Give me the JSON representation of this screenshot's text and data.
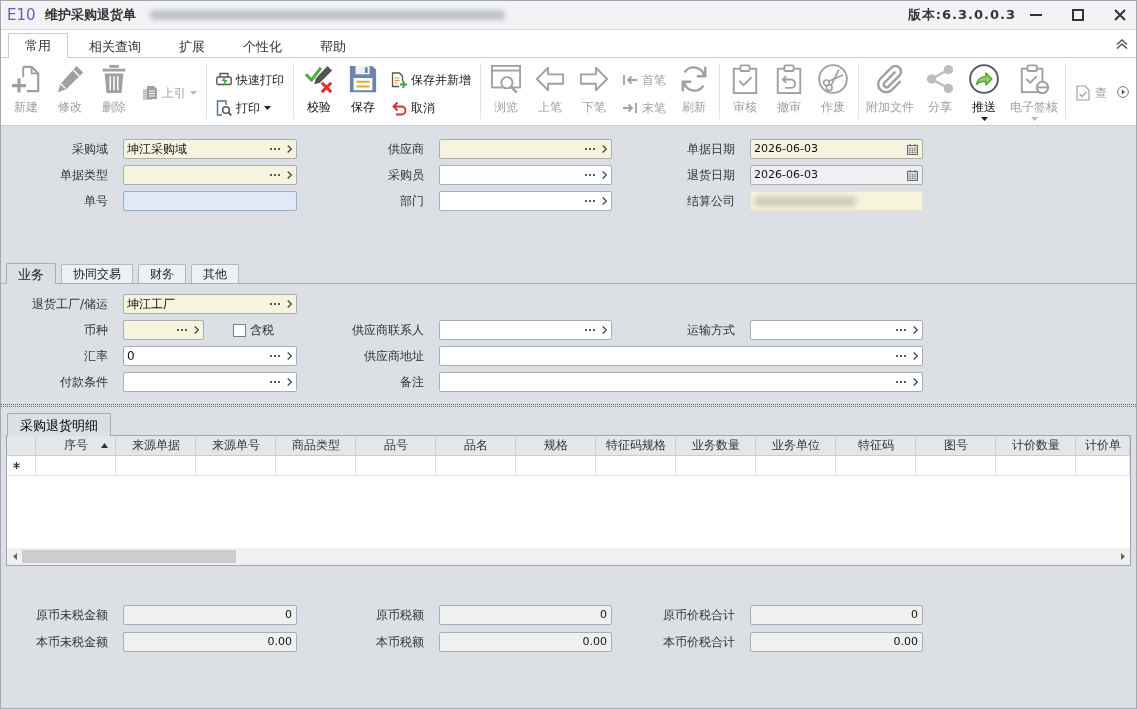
{
  "window": {
    "logo": "E10",
    "title": "维护采购退货单",
    "title_blurred": true,
    "version": "版本:6.3.0.0.3"
  },
  "ribbon_tabs": [
    {
      "label": "常用",
      "selected": true
    },
    {
      "label": "相关查询",
      "selected": false
    },
    {
      "label": "扩展",
      "selected": false
    },
    {
      "label": "个性化",
      "selected": false
    },
    {
      "label": "帮助",
      "selected": false
    }
  ],
  "toolbar": [
    {
      "items": [
        {
          "kind": "large",
          "label": "新建",
          "disabled": true
        },
        {
          "kind": "large",
          "label": "修改",
          "disabled": true
        },
        {
          "kind": "large",
          "label": "删除",
          "disabled": true
        },
        {
          "kind": "small",
          "label": "上引",
          "disabled": true,
          "dropdown": true
        }
      ]
    },
    {
      "items": [
        {
          "kind": "small",
          "label": "快速打印",
          "disabled": false
        },
        {
          "kind": "small",
          "label": "打印",
          "disabled": false,
          "dropdown": true
        }
      ]
    },
    {
      "items": [
        {
          "kind": "large",
          "label": "校验",
          "disabled": false
        },
        {
          "kind": "large",
          "label": "保存",
          "disabled": false
        },
        {
          "kind": "small",
          "label": "保存并新增",
          "disabled": false
        },
        {
          "kind": "small",
          "label": "取消",
          "disabled": false
        }
      ]
    },
    {
      "items": [
        {
          "kind": "large",
          "label": "浏览",
          "disabled": true
        },
        {
          "kind": "large",
          "label": "上笔",
          "disabled": true
        },
        {
          "kind": "large",
          "label": "下笔",
          "disabled": true
        },
        {
          "kind": "small",
          "label": "首笔",
          "disabled": true
        },
        {
          "kind": "small",
          "label": "末笔",
          "disabled": true
        },
        {
          "kind": "large",
          "label": "刷新",
          "disabled": true
        }
      ]
    },
    {
      "items": [
        {
          "kind": "large",
          "label": "审核",
          "disabled": true
        },
        {
          "kind": "large",
          "label": "撤审",
          "disabled": true
        },
        {
          "kind": "large",
          "label": "作废",
          "disabled": true
        }
      ]
    },
    {
      "items": [
        {
          "kind": "large",
          "label": "附加文件",
          "disabled": true
        },
        {
          "kind": "large",
          "label": "分享",
          "disabled": true
        },
        {
          "kind": "large",
          "label": "推送",
          "disabled": false,
          "dropdown": true
        },
        {
          "kind": "large",
          "label": "电子签核",
          "disabled": true,
          "dropdown": true
        }
      ]
    },
    {
      "items": [
        {
          "kind": "small",
          "label": "查",
          "disabled": true
        }
      ]
    }
  ],
  "header_form": [
    [
      {
        "label": "采购域",
        "value": "坤江采购域",
        "kind": "lookup",
        "required": true
      },
      {
        "label": "供应商",
        "kind": "lookup",
        "required": true
      },
      {
        "label": "单据日期",
        "value": "2026-06-03",
        "kind": "date",
        "required": true
      }
    ],
    [
      {
        "label": "单据类型",
        "kind": "lookup",
        "required": true
      },
      {
        "label": "采购员",
        "kind": "lookup",
        "required": false
      },
      {
        "label": "退货日期",
        "value": "2026-06-03",
        "kind": "date",
        "required": false,
        "readonly": true
      }
    ],
    [
      {
        "label": "单号",
        "kind": "text",
        "required": false,
        "highlighted": true
      },
      {
        "label": "部门",
        "kind": "lookup",
        "required": false
      },
      {
        "label": "结算公司",
        "kind": "text",
        "required": true,
        "blurred": true
      }
    ]
  ],
  "detail_tabs": [
    {
      "label": "业务",
      "selected": true
    },
    {
      "label": "协同交易",
      "selected": false
    },
    {
      "label": "财务",
      "selected": false
    },
    {
      "label": "其他",
      "selected": false
    }
  ],
  "detail_form": [
    [
      {
        "label": "退货工厂/储运",
        "value": "坤江工厂",
        "kind": "lookup",
        "required": true
      }
    ],
    [
      {
        "label": "币种",
        "kind": "lookup",
        "required": true,
        "checkbox": {
          "label": "含税",
          "checked": false
        }
      },
      {
        "label": "供应商联系人",
        "kind": "lookup",
        "required": false
      },
      {
        "label": "运输方式",
        "kind": "lookup",
        "required": false
      }
    ],
    [
      {
        "label": "汇率",
        "value": "0",
        "kind": "lookup",
        "required": false
      },
      {
        "label": "供应商地址",
        "kind": "lookup",
        "required": false
      }
    ],
    [
      {
        "label": "付款条件",
        "kind": "lookup",
        "required": false
      },
      {
        "label": "备注",
        "kind": "lookup",
        "required": false
      }
    ]
  ],
  "detail_grid": {
    "tab": {
      "label": "采购退货明细",
      "selected": true
    },
    "columns": [
      {
        "label": "序号",
        "sorted": true
      },
      {
        "label": "来源单据"
      },
      {
        "label": "来源单号"
      },
      {
        "label": "商品类型"
      },
      {
        "label": "品号"
      },
      {
        "label": "品名"
      },
      {
        "label": "规格"
      },
      {
        "label": "特征码规格"
      },
      {
        "label": "业务数量"
      },
      {
        "label": "业务单位"
      },
      {
        "label": "特征码"
      },
      {
        "label": "图号"
      },
      {
        "label": "计价数量"
      },
      {
        "label": "计价单"
      }
    ]
  },
  "totals": [
    [
      {
        "label": "原币未税金额",
        "value": "0",
        "readonly": true
      },
      {
        "label": "原币税额",
        "value": "0",
        "readonly": true
      },
      {
        "label": "原币价税合计",
        "value": "0",
        "readonly": true
      }
    ],
    [
      {
        "label": "本币未税金额",
        "value": "0.00",
        "readonly": true
      },
      {
        "label": "本币税额",
        "value": "0.00",
        "readonly": true
      },
      {
        "label": "本币价税合计",
        "value": "0.00",
        "readonly": true
      }
    ]
  ]
}
